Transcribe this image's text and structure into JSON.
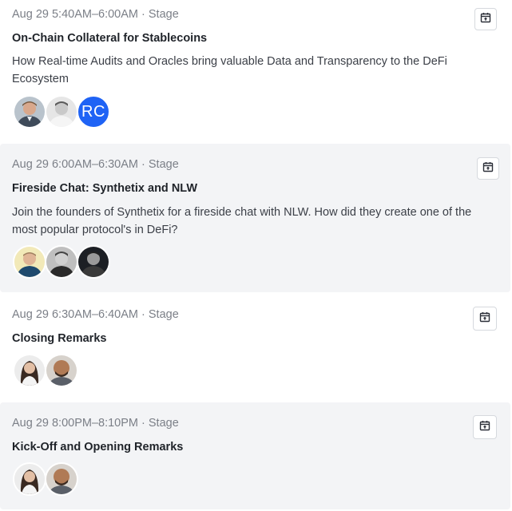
{
  "sessions": [
    {
      "time": "Aug 29 5:40AM–6:00AM",
      "location": "Stage",
      "title": "On-Chain Collateral for Stablecoins",
      "description": "How Real-time Audits and Oracles bring valuable Data and Transparency to the DeFi Ecosystem",
      "speakers": [
        {
          "kind": "photo"
        },
        {
          "kind": "photo"
        },
        {
          "kind": "initials",
          "initials": "RC",
          "color": "#1f63f5"
        }
      ]
    },
    {
      "time": "Aug 29 6:00AM–6:30AM",
      "location": "Stage",
      "title": "Fireside Chat: Synthetix and NLW",
      "description": "Join the founders of Synthetix for a fireside chat with NLW. How did they create one of the most popular protocol's in DeFi?",
      "speakers": [
        {
          "kind": "photo"
        },
        {
          "kind": "photo"
        },
        {
          "kind": "photo"
        }
      ]
    },
    {
      "time": "Aug 29 6:30AM–6:40AM",
      "location": "Stage",
      "title": "Closing Remarks",
      "speakers": [
        {
          "kind": "photo"
        },
        {
          "kind": "photo"
        }
      ]
    },
    {
      "time": "Aug 29 8:00PM–8:10PM",
      "location": "Stage",
      "title": "Kick-Off and Opening Remarks",
      "speakers": [
        {
          "kind": "photo"
        },
        {
          "kind": "photo"
        }
      ]
    }
  ],
  "separator": " · ",
  "icons": {
    "calendar_button": "calendar-add-icon"
  },
  "colors": {
    "alt_row": "#f3f4f6",
    "initials_avatar": "#1f63f5",
    "meta_text": "#7b7f87"
  }
}
